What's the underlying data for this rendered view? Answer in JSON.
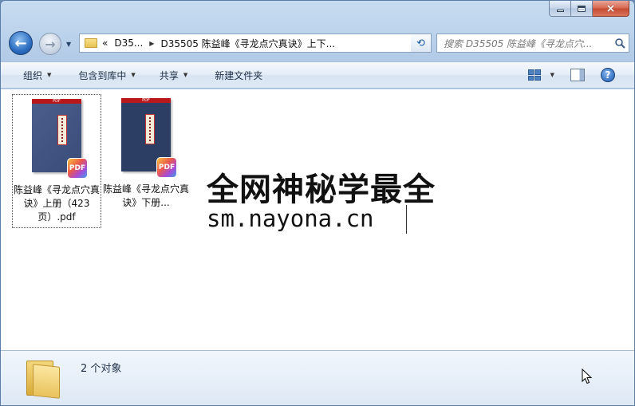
{
  "window": {
    "caption_buttons": {
      "minimize": "minimize",
      "maximize": "maximize",
      "close": "×"
    }
  },
  "nav": {
    "back_glyph": "←",
    "forward_glyph": "→",
    "history_glyph": "▼",
    "breadcrumb": {
      "overflow": "«",
      "items": [
        "D35...",
        "D35505 陈益峰《寻龙点穴真诀》上下..."
      ]
    },
    "refresh_glyph": "⟲",
    "search_placeholder": "搜索 D35505 陈益峰《寻龙点穴..."
  },
  "commandbar": {
    "organize": "组织",
    "include_in_library": "包含到库中",
    "share": "共享",
    "new_folder": "新建文件夹",
    "help": "?"
  },
  "files": [
    {
      "name": "陈益峰《寻龙点穴真诀》上册（423页）.pdf",
      "badge": "PDF",
      "thumb_top": "PDF"
    },
    {
      "name": "陈益峰《寻龙点穴真诀》下册...",
      "badge": "PDF",
      "thumb_top": "PDF"
    }
  ],
  "watermark": {
    "line1": "全网神秘学最全",
    "line2": "sm.nayona.cn"
  },
  "details": {
    "count": "2 个对象"
  },
  "colors": {
    "titlebar": "#c8dcf0",
    "close_button": "#c44a30",
    "pdf_banner": "#b8171c",
    "book_cover": "#2c3e63"
  }
}
